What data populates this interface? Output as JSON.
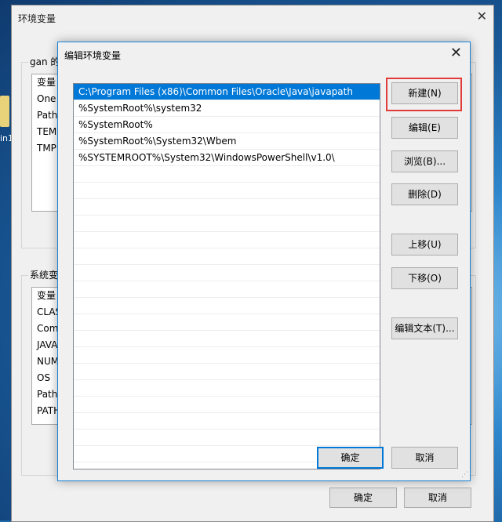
{
  "desktop": {
    "icon_label": "in1"
  },
  "bg_window": {
    "title": "环境变量",
    "user_group_label": "gan 的",
    "user_vars": {
      "header": "变量",
      "items": [
        "One",
        "Path",
        "TEM",
        "TMP"
      ]
    },
    "system_group_label": "系统变",
    "system_vars": {
      "header": "变量",
      "items": [
        "CLAS",
        "Com",
        "JAVA",
        "NUM",
        "OS",
        "Path",
        "PATH"
      ]
    },
    "ok_label": "确定",
    "cancel_label": "取消"
  },
  "dialog": {
    "title": "编辑环境变量",
    "paths": [
      "C:\\Program Files (x86)\\Common Files\\Oracle\\Java\\javapath",
      "%SystemRoot%\\system32",
      "%SystemRoot%",
      "%SystemRoot%\\System32\\Wbem",
      "%SYSTEMROOT%\\System32\\WindowsPowerShell\\v1.0\\"
    ],
    "selected_index": 0,
    "buttons": {
      "new": "新建(N)",
      "edit": "编辑(E)",
      "browse": "浏览(B)...",
      "delete": "删除(D)",
      "move_up": "上移(U)",
      "move_down": "下移(O)",
      "edit_text": "编辑文本(T)..."
    },
    "ok_label": "确定",
    "cancel_label": "取消"
  },
  "colors": {
    "accent": "#0078d7",
    "highlight": "#e23b3b"
  }
}
